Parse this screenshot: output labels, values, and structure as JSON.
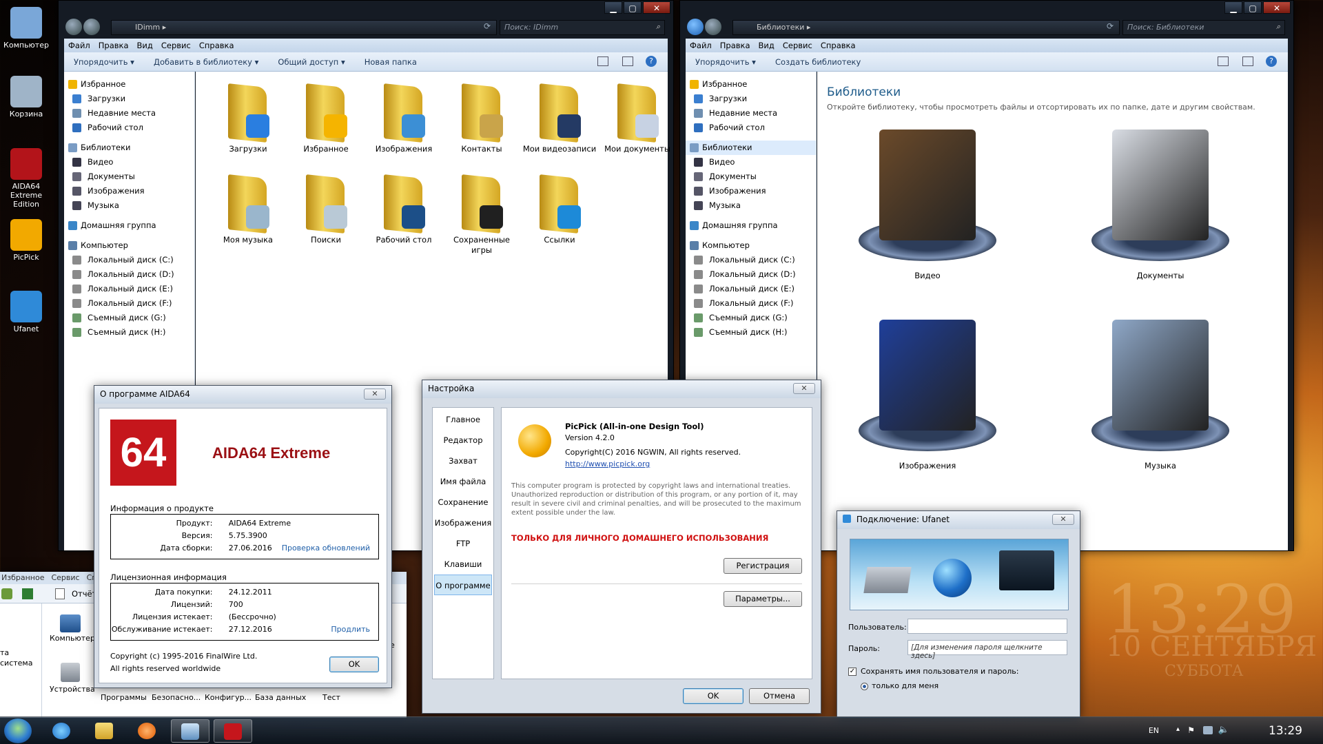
{
  "desktop": {
    "icons": [
      {
        "label": "Компьютер",
        "color": "#7aa7d8"
      },
      {
        "label": "Корзина",
        "color": "#9fb4c8"
      },
      {
        "label": "AIDA64 Extreme Edition",
        "color": "#b3141a"
      },
      {
        "label": "PicPick",
        "color": "#f2a900"
      },
      {
        "label": "Ufanet",
        "color": "#2f8ad8"
      }
    ],
    "clock": {
      "time": "13:29",
      "date": "10 СЕНТЯБРЯ",
      "day": "СУББОТА"
    }
  },
  "explorer_left": {
    "address": "IDimm",
    "search": "Поиск: IDimm",
    "menu": [
      "Файл",
      "Правка",
      "Вид",
      "Сервис",
      "Справка"
    ],
    "toolbar": [
      "Упорядочить ▾",
      "Добавить в библиотеку ▾",
      "Общий доступ ▾",
      "Новая папка"
    ],
    "nav": [
      {
        "label": "Избранное",
        "header": true,
        "color": "#f0b400"
      },
      {
        "label": "Загрузки",
        "color": "#3b7fd0"
      },
      {
        "label": "Недавние места",
        "color": "#6f8fb0"
      },
      {
        "label": "Рабочий стол",
        "color": "#2f6fbf"
      },
      {
        "gap": true
      },
      {
        "label": "Библиотеки",
        "header": true,
        "color": "#7a9cc4"
      },
      {
        "label": "Видео",
        "color": "#334"
      },
      {
        "label": "Документы",
        "color": "#667"
      },
      {
        "label": "Изображения",
        "color": "#556"
      },
      {
        "label": "Музыка",
        "color": "#445"
      },
      {
        "gap": true
      },
      {
        "label": "Домашняя группа",
        "header": true,
        "color": "#3a86c8"
      },
      {
        "gap": true
      },
      {
        "label": "Компьютер",
        "header": true,
        "color": "#5a7fa8"
      },
      {
        "label": "Локальный диск (C:)",
        "color": "#8a8a8a"
      },
      {
        "label": "Локальный диск (D:)",
        "color": "#8a8a8a"
      },
      {
        "label": "Локальный диск (E:)",
        "color": "#8a8a8a"
      },
      {
        "label": "Локальный диск (F:)",
        "color": "#8a8a8a"
      },
      {
        "label": "Съемный диск (G:)",
        "color": "#6a9a6a"
      },
      {
        "label": "Съемный диск (H:)",
        "color": "#6a9a6a"
      }
    ],
    "folders": [
      {
        "label": "Загрузки",
        "badge": "#2a7ee0"
      },
      {
        "label": "Избранное",
        "badge": "#f5b400"
      },
      {
        "label": "Изображения",
        "badge": "#3c8fd5"
      },
      {
        "label": "Контакты",
        "badge": "#c9a44a"
      },
      {
        "label": "Мои видеозаписи",
        "badge": "#243a64"
      },
      {
        "label": "Мои документы",
        "badge": "#c7d2e3"
      },
      {
        "label": "Моя музыка",
        "badge": "#9ab6cc"
      },
      {
        "label": "Поиски",
        "badge": "#b9c9d6"
      },
      {
        "label": "Рабочий стол",
        "badge": "#1c4f88"
      },
      {
        "label": "Сохраненные игры",
        "badge": "#202020"
      },
      {
        "label": "Ссылки",
        "badge": "#1d8ad8"
      }
    ]
  },
  "explorer_right": {
    "address": "Библиотеки",
    "search": "Поиск: Библиотеки",
    "menu": [
      "Файл",
      "Правка",
      "Вид",
      "Сервис",
      "Справка"
    ],
    "toolbar": [
      "Упорядочить ▾",
      "Создать библиотеку"
    ],
    "heading": "Библиотеки",
    "subheading": "Откройте библиотеку, чтобы просмотреть файлы и отсортировать их по папке, дате и другим свойствам.",
    "libraries": [
      {
        "label": "Видео",
        "art": "#6b4a2a"
      },
      {
        "label": "Документы",
        "art": "#d9dde4"
      },
      {
        "label": "Изображения",
        "art": "#1f3f9a"
      },
      {
        "label": "Музыка",
        "art": "#8fa8c8"
      }
    ]
  },
  "aida_dialog": {
    "title": "О программе AIDA64",
    "logo": "64",
    "product_name": "AIDA64 Extreme",
    "product_info_header": "Информация о продукте",
    "product_info": [
      {
        "k": "Продукт:",
        "v": "AIDA64 Extreme",
        "link": ""
      },
      {
        "k": "Версия:",
        "v": "5.75.3900",
        "link": ""
      },
      {
        "k": "Дата сборки:",
        "v": "27.06.2016",
        "link": "Проверка обновлений"
      }
    ],
    "license_header": "Лицензионная информация",
    "license": [
      {
        "k": "Дата покупки:",
        "v": "24.12.2011",
        "link": ""
      },
      {
        "k": "Лицензий:",
        "v": "700",
        "link": ""
      },
      {
        "k": "Лицензия истекает:",
        "v": "(Бессрочно)",
        "link": ""
      },
      {
        "k": "Обслуживание истекает:",
        "v": "27.12.2016",
        "link": "Продлить"
      }
    ],
    "copyright1": "Copyright (c) 1995-2016 FinalWire Ltd.",
    "copyright2": "All rights reserved worldwide",
    "ok": "OK"
  },
  "picpick_dialog": {
    "title": "Настройка",
    "nav": [
      "Главное",
      "Редактор",
      "Захват",
      "Имя файла",
      "Сохранение",
      "Изображения",
      "FTP",
      "Клавиши",
      "О программе"
    ],
    "selected_nav": "О программе",
    "app_name": "PicPick (All-in-one Design Tool)",
    "version": "Version 4.2.0",
    "copyright": "Copyright(C) 2016 NGWIN, All rights reserved.",
    "url": "http://www.picpick.org",
    "legal": "This computer program is protected by copyright laws and international treaties. Unauthorized reproduction or distribution of this program, or any portion of it, may result in severe civil and criminal penalties, and will be prosecuted to the maximum extent possible under the law.",
    "personal_use": "ТОЛЬКО ДЛЯ ЛИЧНОГО ДОМАШНЕГО ИСПОЛЬЗОВАНИЯ",
    "register_btn": "Регистрация",
    "params_btn": "Параметры...",
    "ok": "OK",
    "cancel": "Отмена"
  },
  "ufanet_dialog": {
    "title": "Подключение: Ufanet",
    "user_label": "Пользователь:",
    "user_value": "",
    "pass_label": "Пароль:",
    "pass_placeholder": "[Для изменения пароля щелкните здесь]",
    "save_label": "Сохранять имя пользователя и пароль:",
    "radio_label": "только для меня"
  },
  "bg_window": {
    "menu": [
      "Избранное",
      "Сервис",
      "Справ"
    ],
    "toolbar": "Отчёт",
    "left_lines": [
      "та",
      "система"
    ],
    "items": [
      "Компьютер",
      "Устройства",
      "Программы",
      "Безопасно...",
      "Конфигур...",
      "База данных",
      "Тест"
    ],
    "frag": "е"
  },
  "taskbar": {
    "lang": "EN",
    "time": "13:29"
  }
}
